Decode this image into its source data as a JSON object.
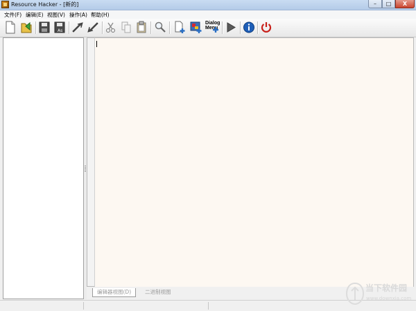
{
  "window": {
    "title": "Resource Hacker - [新的]",
    "minimize_label": "–",
    "maximize_label": "□",
    "close_label": "X"
  },
  "menu": {
    "items": [
      {
        "label": "文件(F)"
      },
      {
        "label": "编辑(E)"
      },
      {
        "label": "视图(V)"
      },
      {
        "label": "操作(A)"
      },
      {
        "label": "帮助(H)"
      }
    ]
  },
  "toolbar": {
    "buttons": [
      {
        "icon": "new-file-icon"
      },
      {
        "icon": "open-folder-icon"
      },
      {
        "icon": "save-icon"
      },
      {
        "icon": "save-as-icon"
      },
      {
        "icon": "compile-arrow-icon"
      },
      {
        "icon": "back-arrow-icon"
      },
      {
        "icon": "cut-icon"
      },
      {
        "icon": "copy-icon"
      },
      {
        "icon": "paste-icon"
      },
      {
        "icon": "find-icon"
      },
      {
        "icon": "add-resource-icon"
      },
      {
        "icon": "add-image-icon"
      },
      {
        "icon": "dialog-menu-icon",
        "text_line1": "Dialog",
        "text_line2": "Menu"
      },
      {
        "icon": "run-script-icon"
      },
      {
        "icon": "info-icon"
      },
      {
        "icon": "exit-icon"
      }
    ]
  },
  "tabs": {
    "editor_view": "编辑器视图(D)",
    "binary_view": "二进制视图"
  },
  "watermark": {
    "title": "当下软件园",
    "url": "www.downxia.com"
  },
  "colors": {
    "editor_background": "#fdf8f2",
    "info_blue": "#1f5fb8",
    "exit_red": "#c8201a",
    "run_gray": "#5a5a5a"
  }
}
